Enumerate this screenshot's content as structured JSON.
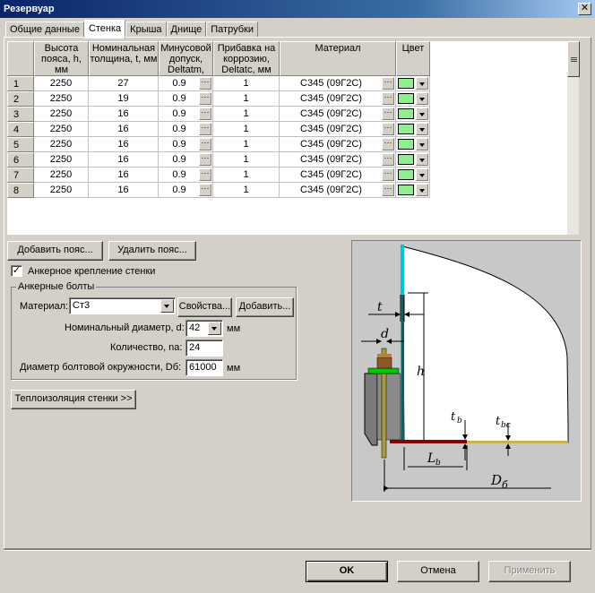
{
  "window": {
    "title": "Резервуар",
    "close_label": "✕"
  },
  "tabs": [
    {
      "label": "Общие данные"
    },
    {
      "label": "Стенка"
    },
    {
      "label": "Крыша"
    },
    {
      "label": "Днище"
    },
    {
      "label": "Патрубки"
    }
  ],
  "table": {
    "headers": [
      "",
      "Высота пояса, h, мм",
      "Номинальная толщина, t, мм",
      "Минусовой допуск, Deltatm,",
      "Прибавка на коррозию, Deltatc, мм",
      "Материал",
      "Цвет"
    ],
    "ellipsis": "···",
    "rows": [
      {
        "n": "1",
        "h": "2250",
        "t": "27",
        "dtm": "0.9",
        "dtc": "1",
        "mat": "С345 (09Г2С)"
      },
      {
        "n": "2",
        "h": "2250",
        "t": "19",
        "dtm": "0.9",
        "dtc": "1",
        "mat": "С345 (09Г2С)"
      },
      {
        "n": "3",
        "h": "2250",
        "t": "16",
        "dtm": "0.9",
        "dtc": "1",
        "mat": "С345 (09Г2С)"
      },
      {
        "n": "4",
        "h": "2250",
        "t": "16",
        "dtm": "0.9",
        "dtc": "1",
        "mat": "С345 (09Г2С)"
      },
      {
        "n": "5",
        "h": "2250",
        "t": "16",
        "dtm": "0.9",
        "dtc": "1",
        "mat": "С345 (09Г2С)"
      },
      {
        "n": "6",
        "h": "2250",
        "t": "16",
        "dtm": "0.9",
        "dtc": "1",
        "mat": "С345 (09Г2С)"
      },
      {
        "n": "7",
        "h": "2250",
        "t": "16",
        "dtm": "0.9",
        "dtc": "1",
        "mat": "С345 (09Г2С)"
      },
      {
        "n": "8",
        "h": "2250",
        "t": "16",
        "dtm": "0.9",
        "dtc": "1",
        "mat": "С345 (09Г2С)"
      }
    ],
    "swatch_color": "#90ee90"
  },
  "buttons": {
    "add_belt": "Добавить пояс...",
    "remove_belt": "Удалить пояс...",
    "properties": "Свойства...",
    "add": "Добавить...",
    "insulation": "Теплоизоляция стенки >>",
    "ok": "OK",
    "cancel": "Отмена",
    "apply": "Применить"
  },
  "anchor": {
    "checkbox_label": "Анкерное крепление стенки",
    "checked_mark": "✓",
    "group_title": "Анкерные болты",
    "material_label": "Материал:",
    "material_value": "Ст3",
    "diameter_label": "Номинальный диаметр, d:",
    "diameter_value": "42",
    "diameter_unit": "мм",
    "count_label": "Количество, na:",
    "count_value": "24",
    "circle_label": "Диаметр болтовой окружности, Dб:",
    "circle_value": "61000",
    "circle_unit": "мм"
  },
  "diagram": {
    "label_t": "t",
    "label_d": "d",
    "label_h": "h",
    "label_tb": "t",
    "label_tb_sub": "b",
    "label_tbc": "t",
    "label_tbc_sub": "bc",
    "label_lb": "L",
    "label_lb_sub": "b",
    "label_d6": "D",
    "label_d6_sub": "б"
  }
}
